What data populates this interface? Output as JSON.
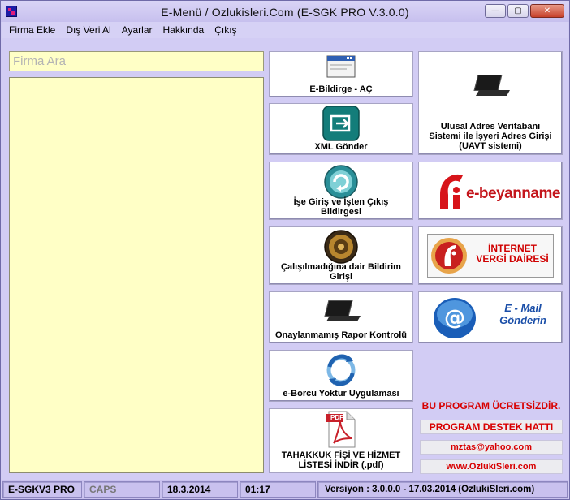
{
  "window": {
    "title": "E-Menü / Ozlukisleri.Com  (E-SGK PRO V.3.0.0)",
    "controls": {
      "minimize": "—",
      "maximize": "▢",
      "close": "✕"
    }
  },
  "menu": [
    "Firma Ekle",
    "Dış Veri Al",
    "Ayarlar",
    "Hakkında",
    "Çıkış"
  ],
  "search": {
    "placeholder": "Firma Ara",
    "value": ""
  },
  "tiles": {
    "ebildirge": "E-Bildirge - AÇ",
    "xml": "XML Gönder",
    "ise_giris_line1": "İşe Giriş ve İşten Çıkış",
    "ise_giris_line2": "Bildirgesi",
    "calisilmadigina_line1": "Çalışılmadığına dair Bildirim",
    "calisilmadigina_line2": "Girişi",
    "onaylanmamis": "Onaylanmamış Rapor Kontrolü",
    "eborcu": "e-Borcu Yoktur Uygulaması",
    "tahakkuk_line1": "TAHAKKUK FİŞİ VE HİZMET",
    "tahakkuk_line2": "LİSTESİ İNDİR (.pdf)",
    "uavt_line1": "Ulusal Adres Veritabanı",
    "uavt_line2": "Sistemi ile İşyeri Adres Girişi",
    "uavt_line3": "(UAVT sistemi)",
    "ebeyanname": "e-beyanname",
    "internet_vd_line1": "İNTERNET",
    "internet_vd_line2": "VERGİ DAİRESİ",
    "email_line1": "E - Mail",
    "email_line2": "Gönderin",
    "pdf_badge": "PDF"
  },
  "links": {
    "free": "BU PROGRAM ÜCRETSİZDİR.",
    "support": "PROGRAM DESTEK HATTI",
    "email": "mztas@yahoo.com",
    "web": "www.OzlukiSleri.com"
  },
  "status": {
    "product": "E-SGKV3 PRO",
    "caps": "CAPS",
    "date": "18.3.2014",
    "time": "01:17",
    "version": "Versiyon : 3.0.0.0 - 17.03.2014 (OzlukiSleri.com)"
  },
  "colors": {
    "background": "#d2ccf4",
    "list_bg": "#ffffc6",
    "accent_red": "#d80000",
    "email_blue": "#1a4ea8"
  }
}
